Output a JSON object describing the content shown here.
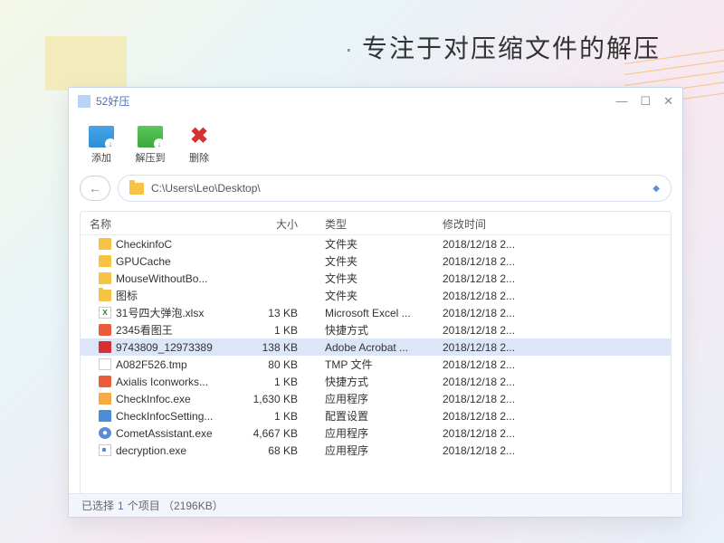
{
  "tagline": "专注于对压缩文件的解压",
  "window_title": "52好压",
  "toolbar": {
    "add": "添加",
    "extract": "解压到",
    "delete": "删除"
  },
  "path": "C:\\Users\\Leo\\Desktop\\",
  "columns": {
    "name": "名称",
    "size": "大小",
    "type": "类型",
    "date": "修改时间"
  },
  "rows": [
    {
      "icon": "folder",
      "name": "CheckinfoC",
      "size": "",
      "type": "文件夹",
      "date": "2018/12/18 2...",
      "selected": false
    },
    {
      "icon": "folder",
      "name": "GPUCache",
      "size": "",
      "type": "文件夹",
      "date": "2018/12/18 2...",
      "selected": false
    },
    {
      "icon": "folder",
      "name": "MouseWithoutBo...",
      "size": "",
      "type": "文件夹",
      "date": "2018/12/18 2...",
      "selected": false
    },
    {
      "icon": "folder",
      "name": "图标",
      "size": "",
      "type": "文件夹",
      "date": "2018/12/18 2...",
      "selected": false
    },
    {
      "icon": "excel",
      "name": "31号四大弹泡.xlsx",
      "size": "13 KB",
      "type": "Microsoft Excel ...",
      "date": "2018/12/18 2...",
      "selected": false
    },
    {
      "icon": "shortcut",
      "name": "2345看图王",
      "size": "1 KB",
      "type": "快捷方式",
      "date": "2018/12/18 2...",
      "selected": false
    },
    {
      "icon": "pdf",
      "name": "9743809_12973389",
      "size": "138 KB",
      "type": "Adobe Acrobat ...",
      "date": "2018/12/18 2...",
      "selected": true
    },
    {
      "icon": "tmp",
      "name": "A082F526.tmp",
      "size": "80 KB",
      "type": "TMP 文件",
      "date": "2018/12/18 2...",
      "selected": false
    },
    {
      "icon": "shortcut",
      "name": "Axialis Iconworks...",
      "size": "1 KB",
      "type": "快捷方式",
      "date": "2018/12/18 2...",
      "selected": false
    },
    {
      "icon": "exe1",
      "name": "CheckInfoc.exe",
      "size": "1,630 KB",
      "type": "应用程序",
      "date": "2018/12/18 2...",
      "selected": false
    },
    {
      "icon": "exe2",
      "name": "CheckInfocSetting...",
      "size": "1 KB",
      "type": "配置设置",
      "date": "2018/12/18 2...",
      "selected": false
    },
    {
      "icon": "comet",
      "name": "CometAssistant.exe",
      "size": "4,667 KB",
      "type": "应用程序",
      "date": "2018/12/18 2...",
      "selected": false
    },
    {
      "icon": "exe3",
      "name": "decryption.exe",
      "size": "68 KB",
      "type": "应用程序",
      "date": "2018/12/18 2...",
      "selected": false
    }
  ],
  "status": {
    "prefix": "已选择",
    "count": "1",
    "suffix": "个项目 （2196KB）"
  }
}
